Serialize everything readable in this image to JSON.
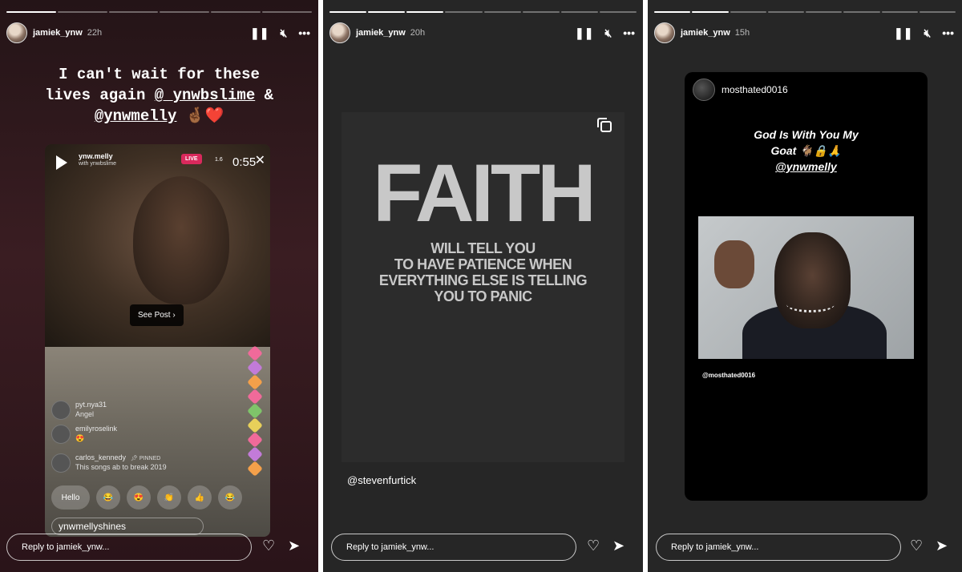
{
  "stories": [
    {
      "username": "jamiek_ynw",
      "time": "22h",
      "progress": {
        "segments": 6,
        "completed": 1
      },
      "caption_lines": [
        "I can't wait for these",
        "lives again ",
        "@_ynwbslime",
        " &",
        "@ynwmelly",
        " 🤞🏾❤️"
      ],
      "live": {
        "user": "ynw.melly",
        "with": "with ynwbslime",
        "badge": "LIVE",
        "viewers": "1.6",
        "duration": "0:55",
        "see_post": "See Post",
        "comments": [
          {
            "name": "pyt.nya31",
            "msg": "Angel"
          },
          {
            "name": "emilyroselink",
            "msg": "😍"
          },
          {
            "name": "carlos_kennedy",
            "pinned": "PINNED",
            "msg": "This songs ab to break 2019"
          }
        ],
        "reactions": [
          "Hello",
          "😂",
          "😍",
          "👏",
          "👍",
          "😂"
        ],
        "input_text": "ynwmellyshines"
      },
      "reply_placeholder": "Reply to jamiek_ynw..."
    },
    {
      "username": "jamiek_ynw",
      "time": "20h",
      "progress": {
        "segments": 8,
        "completed": 3
      },
      "quote_title": "FAITH",
      "quote_lines": [
        "WILL TELL YOU",
        "TO HAVE PATIENCE WHEN",
        "EVERYTHING ELSE IS TELLING",
        "YOU TO PANIC"
      ],
      "credit": "@stevenfurtick",
      "reply_placeholder": "Reply to jamiek_ynw..."
    },
    {
      "username": "jamiek_ynw",
      "time": "15h",
      "progress": {
        "segments": 8,
        "completed": 2
      },
      "post_user": "mosthated0016",
      "post_caption_lines": [
        "God Is With You My",
        "Goat 🐐🔒🙏",
        "@ynwmelly"
      ],
      "post_credit": "@mosthated0016",
      "reply_placeholder": "Reply to jamiek_ynw..."
    }
  ],
  "icons": {
    "pause": "pause-icon",
    "mute": "mute-icon",
    "more": "more-icon",
    "heart": "heart-icon",
    "send": "send-icon"
  }
}
